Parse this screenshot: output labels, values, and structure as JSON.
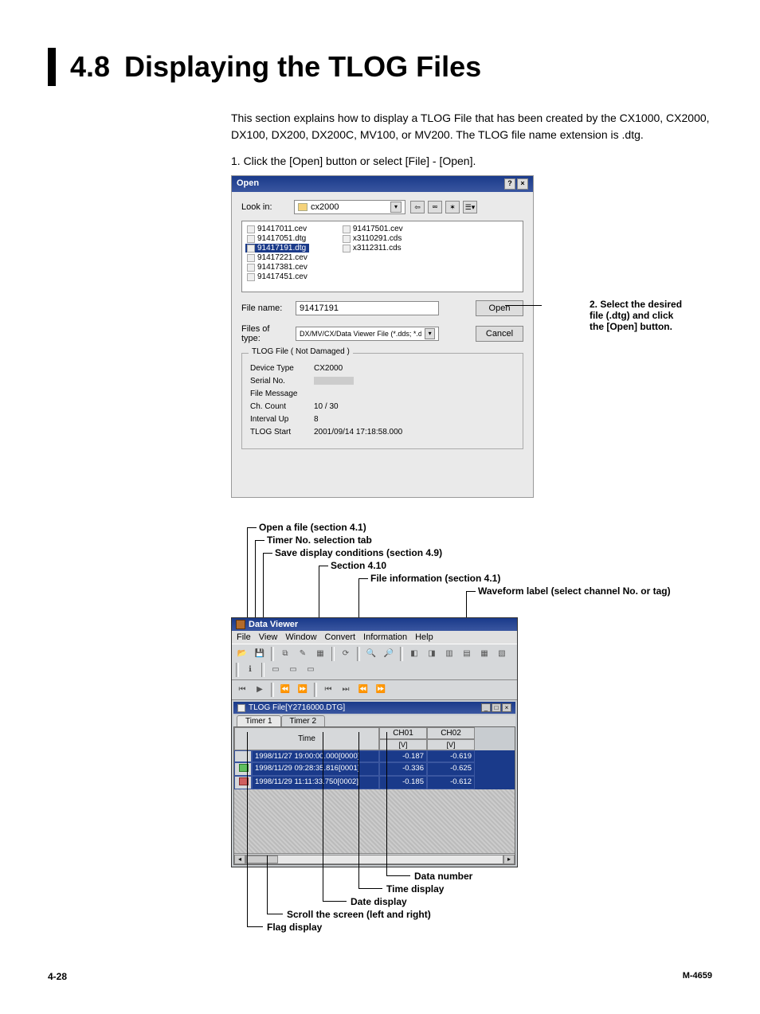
{
  "heading": {
    "number": "4.8",
    "title": "Displaying the TLOG Files"
  },
  "intro_paragraph": "This section explains how to display a TLOG File that has been created by the CX1000, CX2000, DX100, DX200, DX200C, MV100, or MV200. The TLOG file name extension is .dtg.",
  "step1": "1.    Click the [Open] button or select [File] - [Open].",
  "open_dialog": {
    "title": "Open",
    "lookin_label": "Look in:",
    "lookin_value": "cx2000",
    "files_left": [
      "91417011.cev",
      "91417051.dtg",
      "91417191.dtg",
      "91417221.cev",
      "91417381.cev",
      "91417451.cev"
    ],
    "files_right": [
      "91417501.cev",
      "x3110291.cds",
      "x3112311.cds"
    ],
    "selected_file": "91417191.dtg",
    "filename_label": "File name:",
    "filename_value": "91417191",
    "type_label": "Files of type:",
    "type_value": "DX/MV/CX/Data Viewer File (*.dds; *.dev; *",
    "open_btn": "Open",
    "cancel_btn": "Cancel",
    "group_title": "TLOG File ( Not Damaged )",
    "info": {
      "device_type_k": "Device Type",
      "device_type_v": "CX2000",
      "serial_k": "Serial No.",
      "filemsg_k": "File Message",
      "chcount_k": "Ch. Count",
      "chcount_v": "10 / 30",
      "interval_k": "Interval Up",
      "interval_v": "8",
      "tlogstart_k": "TLOG Start",
      "tlogstart_v": "2001/09/14 17:18:58.000"
    }
  },
  "callout_right": {
    "line1": "2. Select the desired",
    "line2": "file (.dtg) and click",
    "line3": "the [Open] button."
  },
  "upper_anno": {
    "a1": "Open a file (section 4.1)",
    "a2": "Timer No. selection tab",
    "a3": "Save display conditions (section 4.9)",
    "a4": "Section 4.10",
    "a5": "File information (section 4.1)",
    "a6": "Waveform label (select channel No. or tag)"
  },
  "app": {
    "title": "Data Viewer",
    "menu": [
      "File",
      "View",
      "Window",
      "Convert",
      "Information",
      "Help"
    ],
    "doc_title": "TLOG File[Y2716000.DTG]",
    "tabs": [
      "Timer 1",
      "Timer 2"
    ],
    "head_time": "Time",
    "head_ch01": "CH01",
    "head_ch02": "CH02",
    "head_unit": "[V]",
    "rows": [
      {
        "time": "1998/11/27 19:00:00.000[0000]",
        "c1": "-0.187",
        "c2": "-0.619"
      },
      {
        "time": "1998/11/29 09:28:35.816[0001]",
        "c1": "-0.336",
        "c2": "-0.625"
      },
      {
        "time": "1998/11/29 11:11:33.750[0002]",
        "c1": "-0.185",
        "c2": "-0.612"
      }
    ]
  },
  "lower_anno": {
    "l1": "Data number",
    "l2": "Time display",
    "l3": "Date display",
    "l4": "Scroll the screen (left and right)",
    "l5": "Flag display"
  },
  "footer": {
    "left": "4-28",
    "right": "M-4659"
  }
}
